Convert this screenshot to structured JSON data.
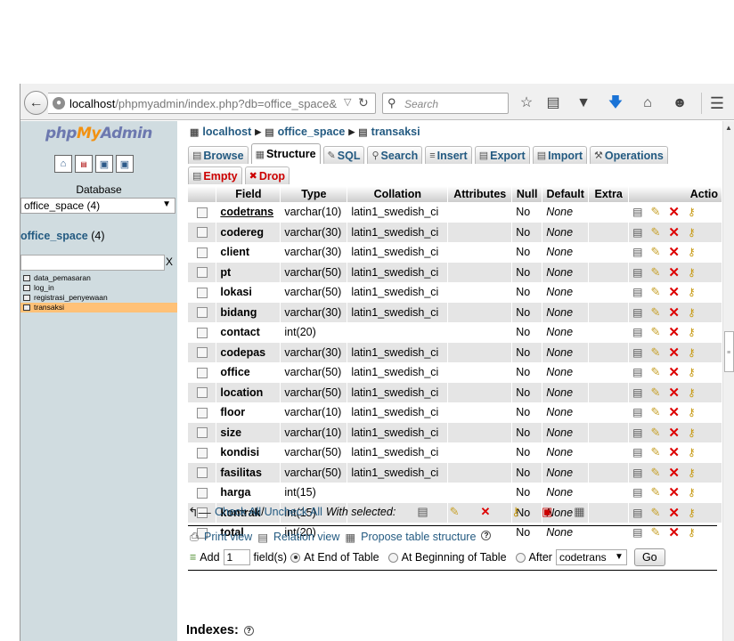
{
  "browser": {
    "url_host": "localhost",
    "url_path": "/phpmyadmin/index.php?db=office_space&tok",
    "search_placeholder": "Search"
  },
  "nav": {
    "logo_php": "php",
    "logo_my": "My",
    "logo_admin": "Admin",
    "database_label": "Database",
    "database_selected": "office_space (4)",
    "db_name": "office_space",
    "db_count": "(4)",
    "filter_clear": "X",
    "tables": [
      "data_pemasaran",
      "log_in",
      "registrasi_penyewaan",
      "transaksi"
    ],
    "active_table": "transaksi"
  },
  "breadcrumb": {
    "server": "localhost",
    "database": "office_space",
    "table": "transaksi"
  },
  "tabs": {
    "browse": "Browse",
    "structure": "Structure",
    "sql": "SQL",
    "search": "Search",
    "insert": "Insert",
    "export": "Export",
    "import": "Import",
    "operations": "Operations",
    "empty": "Empty",
    "drop": "Drop"
  },
  "table": {
    "headers": {
      "field": "Field",
      "type": "Type",
      "collation": "Collation",
      "attributes": "Attributes",
      "null": "Null",
      "default": "Default",
      "extra": "Extra",
      "action": "Actio"
    },
    "rows": [
      {
        "field": "codetrans",
        "type": "varchar(10)",
        "collation": "latin1_swedish_ci",
        "null": "No",
        "default": "None"
      },
      {
        "field": "codereg",
        "type": "varchar(30)",
        "collation": "latin1_swedish_ci",
        "null": "No",
        "default": "None"
      },
      {
        "field": "client",
        "type": "varchar(30)",
        "collation": "latin1_swedish_ci",
        "null": "No",
        "default": "None"
      },
      {
        "field": "pt",
        "type": "varchar(50)",
        "collation": "latin1_swedish_ci",
        "null": "No",
        "default": "None"
      },
      {
        "field": "lokasi",
        "type": "varchar(50)",
        "collation": "latin1_swedish_ci",
        "null": "No",
        "default": "None"
      },
      {
        "field": "bidang",
        "type": "varchar(30)",
        "collation": "latin1_swedish_ci",
        "null": "No",
        "default": "None"
      },
      {
        "field": "contact",
        "type": "int(20)",
        "collation": "",
        "null": "No",
        "default": "None"
      },
      {
        "field": "codepas",
        "type": "varchar(30)",
        "collation": "latin1_swedish_ci",
        "null": "No",
        "default": "None"
      },
      {
        "field": "office",
        "type": "varchar(50)",
        "collation": "latin1_swedish_ci",
        "null": "No",
        "default": "None"
      },
      {
        "field": "location",
        "type": "varchar(50)",
        "collation": "latin1_swedish_ci",
        "null": "No",
        "default": "None"
      },
      {
        "field": "floor",
        "type": "varchar(10)",
        "collation": "latin1_swedish_ci",
        "null": "No",
        "default": "None"
      },
      {
        "field": "size",
        "type": "varchar(10)",
        "collation": "latin1_swedish_ci",
        "null": "No",
        "default": "None"
      },
      {
        "field": "kondisi",
        "type": "varchar(50)",
        "collation": "latin1_swedish_ci",
        "null": "No",
        "default": "None"
      },
      {
        "field": "fasilitas",
        "type": "varchar(50)",
        "collation": "latin1_swedish_ci",
        "null": "No",
        "default": "None"
      },
      {
        "field": "harga",
        "type": "int(15)",
        "collation": "",
        "null": "No",
        "default": "None"
      },
      {
        "field": "kontrak",
        "type": "int(15)",
        "collation": "",
        "null": "No",
        "default": "None"
      },
      {
        "field": "total",
        "type": "int(20)",
        "collation": "",
        "null": "No",
        "default": "None"
      }
    ]
  },
  "bulk": {
    "check_all": "Check All",
    "separator": " / ",
    "uncheck_all": "Uncheck All",
    "with_selected": "With selected:"
  },
  "footer": {
    "print_view": "Print view",
    "relation_view": "Relation view",
    "propose": "Propose table structure",
    "add_label": "Add",
    "add_count": "1",
    "fields_label": "field(s)",
    "at_end": "At End of Table",
    "at_beginning": "At Beginning of Table",
    "after_label": "After",
    "after_selected": "codetrans",
    "go": "Go",
    "indexes": "Indexes:"
  }
}
